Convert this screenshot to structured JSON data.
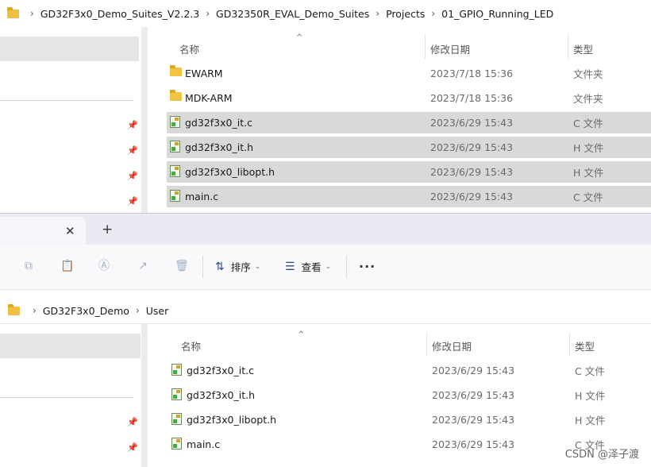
{
  "top_window": {
    "breadcrumb": [
      "GD32F3x0_Demo_Suites_V2.2.3",
      "GD32350R_EVAL_Demo_Suites",
      "Projects",
      "01_GPIO_Running_LED"
    ],
    "columns": {
      "name": "名称",
      "modified": "修改日期",
      "type": "类型"
    },
    "files": [
      {
        "name": "EWARM",
        "modified": "2023/7/18 15:36",
        "type": "文件夹",
        "icon": "folder-icon",
        "selected": false
      },
      {
        "name": "MDK-ARM",
        "modified": "2023/7/18 15:36",
        "type": "文件夹",
        "icon": "folder-icon",
        "selected": false
      },
      {
        "name": "gd32f3x0_it.c",
        "modified": "2023/6/29 15:43",
        "type": "C 文件",
        "icon": "c-file-icon",
        "selected": true
      },
      {
        "name": "gd32f3x0_it.h",
        "modified": "2023/6/29 15:43",
        "type": "H 文件",
        "icon": "h-file-icon",
        "selected": true
      },
      {
        "name": "gd32f3x0_libopt.h",
        "modified": "2023/6/29 15:43",
        "type": "H 文件",
        "icon": "h-file-icon",
        "selected": true
      },
      {
        "name": "main.c",
        "modified": "2023/6/29 15:43",
        "type": "C 文件",
        "icon": "c-file-icon",
        "selected": true
      }
    ]
  },
  "bottom_window": {
    "tab_close": "✕",
    "tab_add": "+",
    "toolbar": {
      "icons": [
        "copy-icon",
        "paste-icon",
        "rename-icon",
        "share-icon",
        "delete-icon"
      ],
      "sort_label": "排序",
      "view_label": "查看",
      "more_label": "···"
    },
    "breadcrumb": [
      "GD32F3x0_Demo",
      "User"
    ],
    "columns": {
      "name": "名称",
      "modified": "修改日期",
      "type": "类型"
    },
    "files": [
      {
        "name": "gd32f3x0_it.c",
        "modified": "2023/6/29 15:43",
        "type": "C 文件",
        "icon": "c-file-icon"
      },
      {
        "name": "gd32f3x0_it.h",
        "modified": "2023/6/29 15:43",
        "type": "H 文件",
        "icon": "h-file-icon"
      },
      {
        "name": "gd32f3x0_libopt.h",
        "modified": "2023/6/29 15:43",
        "type": "H 文件",
        "icon": "h-file-icon"
      },
      {
        "name": "main.c",
        "modified": "2023/6/29 15:43",
        "type": "C 文件",
        "icon": "c-file-icon"
      }
    ]
  },
  "watermark": "CSDN @泽子渡",
  "colors": {
    "selection": "#d9d9d9",
    "nav_selection": "#e5e5e5",
    "folder": "#f2c443",
    "tabstrip": "#eaeaf3"
  }
}
